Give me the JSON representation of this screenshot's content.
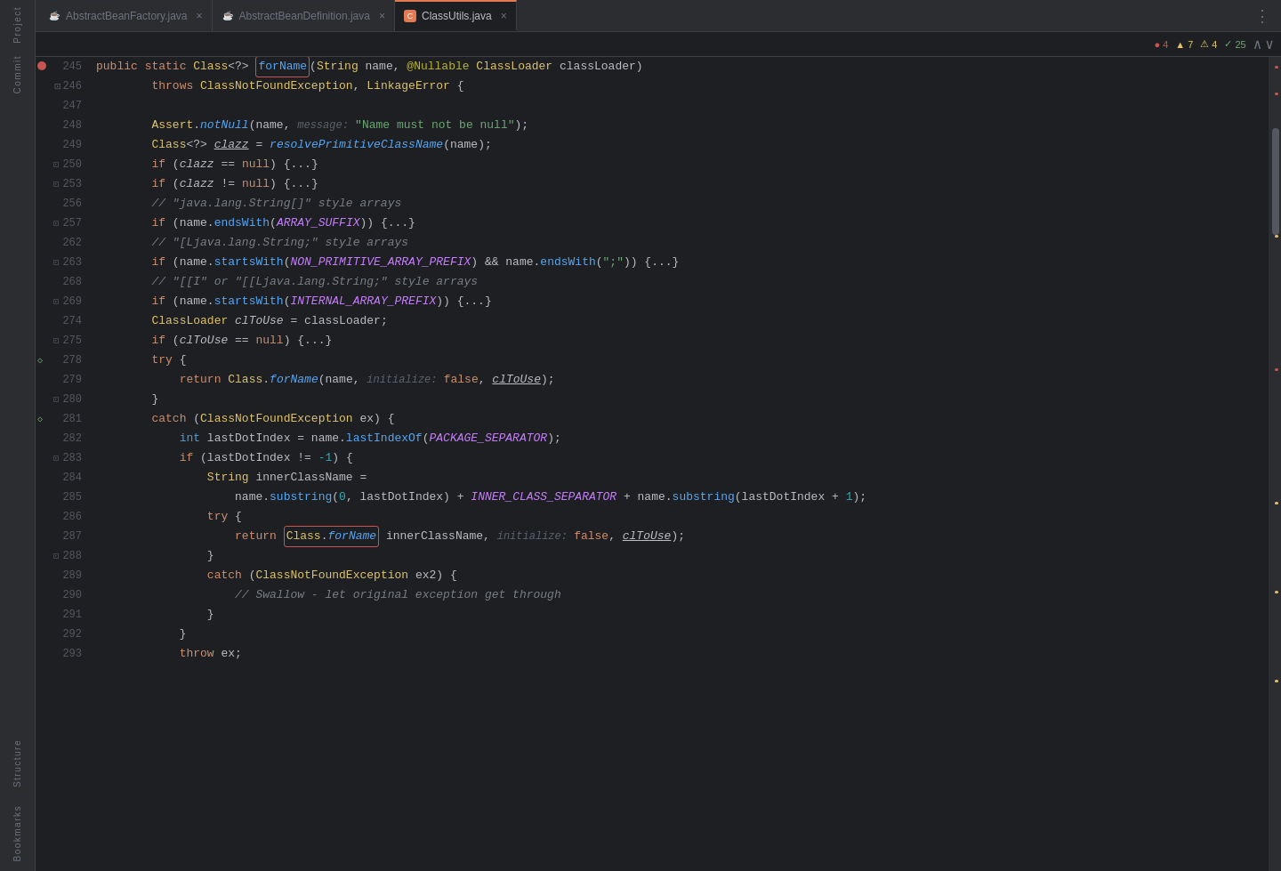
{
  "tabs": [
    {
      "id": "tab1",
      "label": "AbstractBeanFactory.java",
      "icon": "java",
      "active": false,
      "closable": true
    },
    {
      "id": "tab2",
      "label": "AbstractBeanDefinition.java",
      "icon": "java",
      "active": false,
      "closable": true
    },
    {
      "id": "tab3",
      "label": "ClassUtils.java",
      "icon": "java-active",
      "active": true,
      "closable": true
    }
  ],
  "indicators": {
    "errors": "4",
    "warnings": "7",
    "alerts": "4",
    "ok": "25"
  },
  "sidebar_labels": [
    "Project",
    "Commit",
    "Structure",
    "Bookmarks"
  ],
  "lines": [
    {
      "num": "245",
      "indent": "    ",
      "content": "line_245"
    },
    {
      "num": "246",
      "indent": "        ",
      "content": "line_246"
    },
    {
      "num": "247",
      "indent": "",
      "content": "line_247"
    },
    {
      "num": "248",
      "indent": "        ",
      "content": "line_248"
    },
    {
      "num": "249",
      "indent": "        ",
      "content": "line_249"
    },
    {
      "num": "250",
      "indent": "        ",
      "content": "line_250"
    },
    {
      "num": "253",
      "indent": "        ",
      "content": "line_253"
    },
    {
      "num": "256",
      "indent": "        ",
      "content": "line_256"
    },
    {
      "num": "257",
      "indent": "        ",
      "content": "line_257"
    },
    {
      "num": "262",
      "indent": "        ",
      "content": "line_262"
    },
    {
      "num": "263",
      "indent": "        ",
      "content": "line_263"
    },
    {
      "num": "268",
      "indent": "        ",
      "content": "line_268"
    },
    {
      "num": "269",
      "indent": "        ",
      "content": "line_269"
    },
    {
      "num": "274",
      "indent": "        ",
      "content": "line_274"
    },
    {
      "num": "275",
      "indent": "        ",
      "content": "line_275"
    },
    {
      "num": "278",
      "indent": "        ",
      "content": "line_278"
    },
    {
      "num": "279",
      "indent": "            ",
      "content": "line_279"
    },
    {
      "num": "280",
      "indent": "        ",
      "content": "line_280"
    },
    {
      "num": "281",
      "indent": "        ",
      "content": "line_281"
    },
    {
      "num": "282",
      "indent": "            ",
      "content": "line_282"
    },
    {
      "num": "283",
      "indent": "            ",
      "content": "line_283"
    },
    {
      "num": "284",
      "indent": "                ",
      "content": "line_284"
    },
    {
      "num": "285",
      "indent": "                    ",
      "content": "line_285"
    },
    {
      "num": "286",
      "indent": "                ",
      "content": "line_286"
    },
    {
      "num": "287",
      "indent": "                    ",
      "content": "line_287"
    },
    {
      "num": "288",
      "indent": "                ",
      "content": "line_288"
    },
    {
      "num": "289",
      "indent": "                ",
      "content": "line_289"
    },
    {
      "num": "290",
      "indent": "                    ",
      "content": "line_290"
    },
    {
      "num": "291",
      "indent": "                ",
      "content": "line_291"
    },
    {
      "num": "292",
      "indent": "            ",
      "content": "line_292"
    },
    {
      "num": "293",
      "indent": "            ",
      "content": "line_293"
    }
  ]
}
